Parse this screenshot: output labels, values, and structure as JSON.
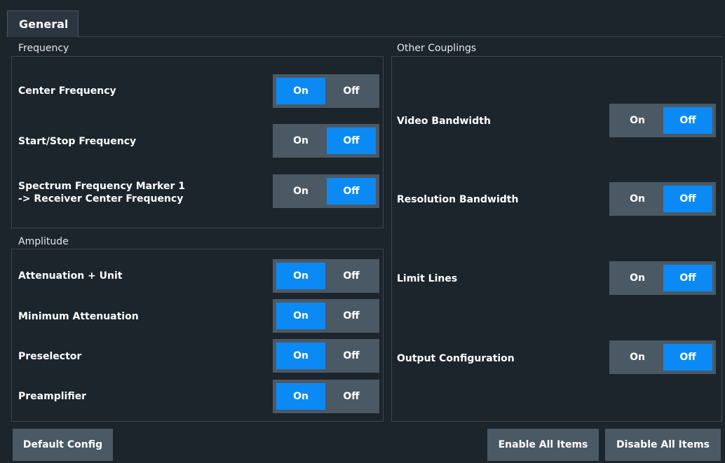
{
  "tabs": [
    {
      "label": "General"
    }
  ],
  "frequency": {
    "title": "Frequency",
    "rows": [
      {
        "label": "Center Frequency",
        "on": "On",
        "off": "Off",
        "selected": "on"
      },
      {
        "label": "Start/Stop Frequency",
        "on": "On",
        "off": "Off",
        "selected": "off"
      },
      {
        "label_line1": "Spectrum Frequency Marker 1",
        "label_line2": "-> Receiver Center Frequency",
        "on": "On",
        "off": "Off",
        "selected": "off"
      }
    ]
  },
  "amplitude": {
    "title": "Amplitude",
    "rows": [
      {
        "label": "Attenuation + Unit",
        "on": "On",
        "off": "Off",
        "selected": "on"
      },
      {
        "label": "Minimum Attenuation",
        "on": "On",
        "off": "Off",
        "selected": "on"
      },
      {
        "label": "Preselector",
        "on": "On",
        "off": "Off",
        "selected": "on"
      },
      {
        "label": "Preamplifier",
        "on": "On",
        "off": "Off",
        "selected": "on"
      }
    ]
  },
  "other": {
    "title": "Other Couplings",
    "rows": [
      {
        "label": "Video Bandwidth",
        "on": "On",
        "off": "Off",
        "selected": "off"
      },
      {
        "label": "Resolution Bandwidth",
        "on": "On",
        "off": "Off",
        "selected": "off"
      },
      {
        "label": "Limit Lines",
        "on": "On",
        "off": "Off",
        "selected": "off"
      },
      {
        "label": "Output Configuration",
        "on": "On",
        "off": "Off",
        "selected": "off"
      }
    ]
  },
  "buttons": {
    "default_config": "Default Config",
    "enable_all": "Enable All Items",
    "disable_all": "Disable All Items"
  },
  "colors": {
    "selected": "#0b8af5",
    "toggle_bg": "#4b5965",
    "background": "#1c242c"
  }
}
